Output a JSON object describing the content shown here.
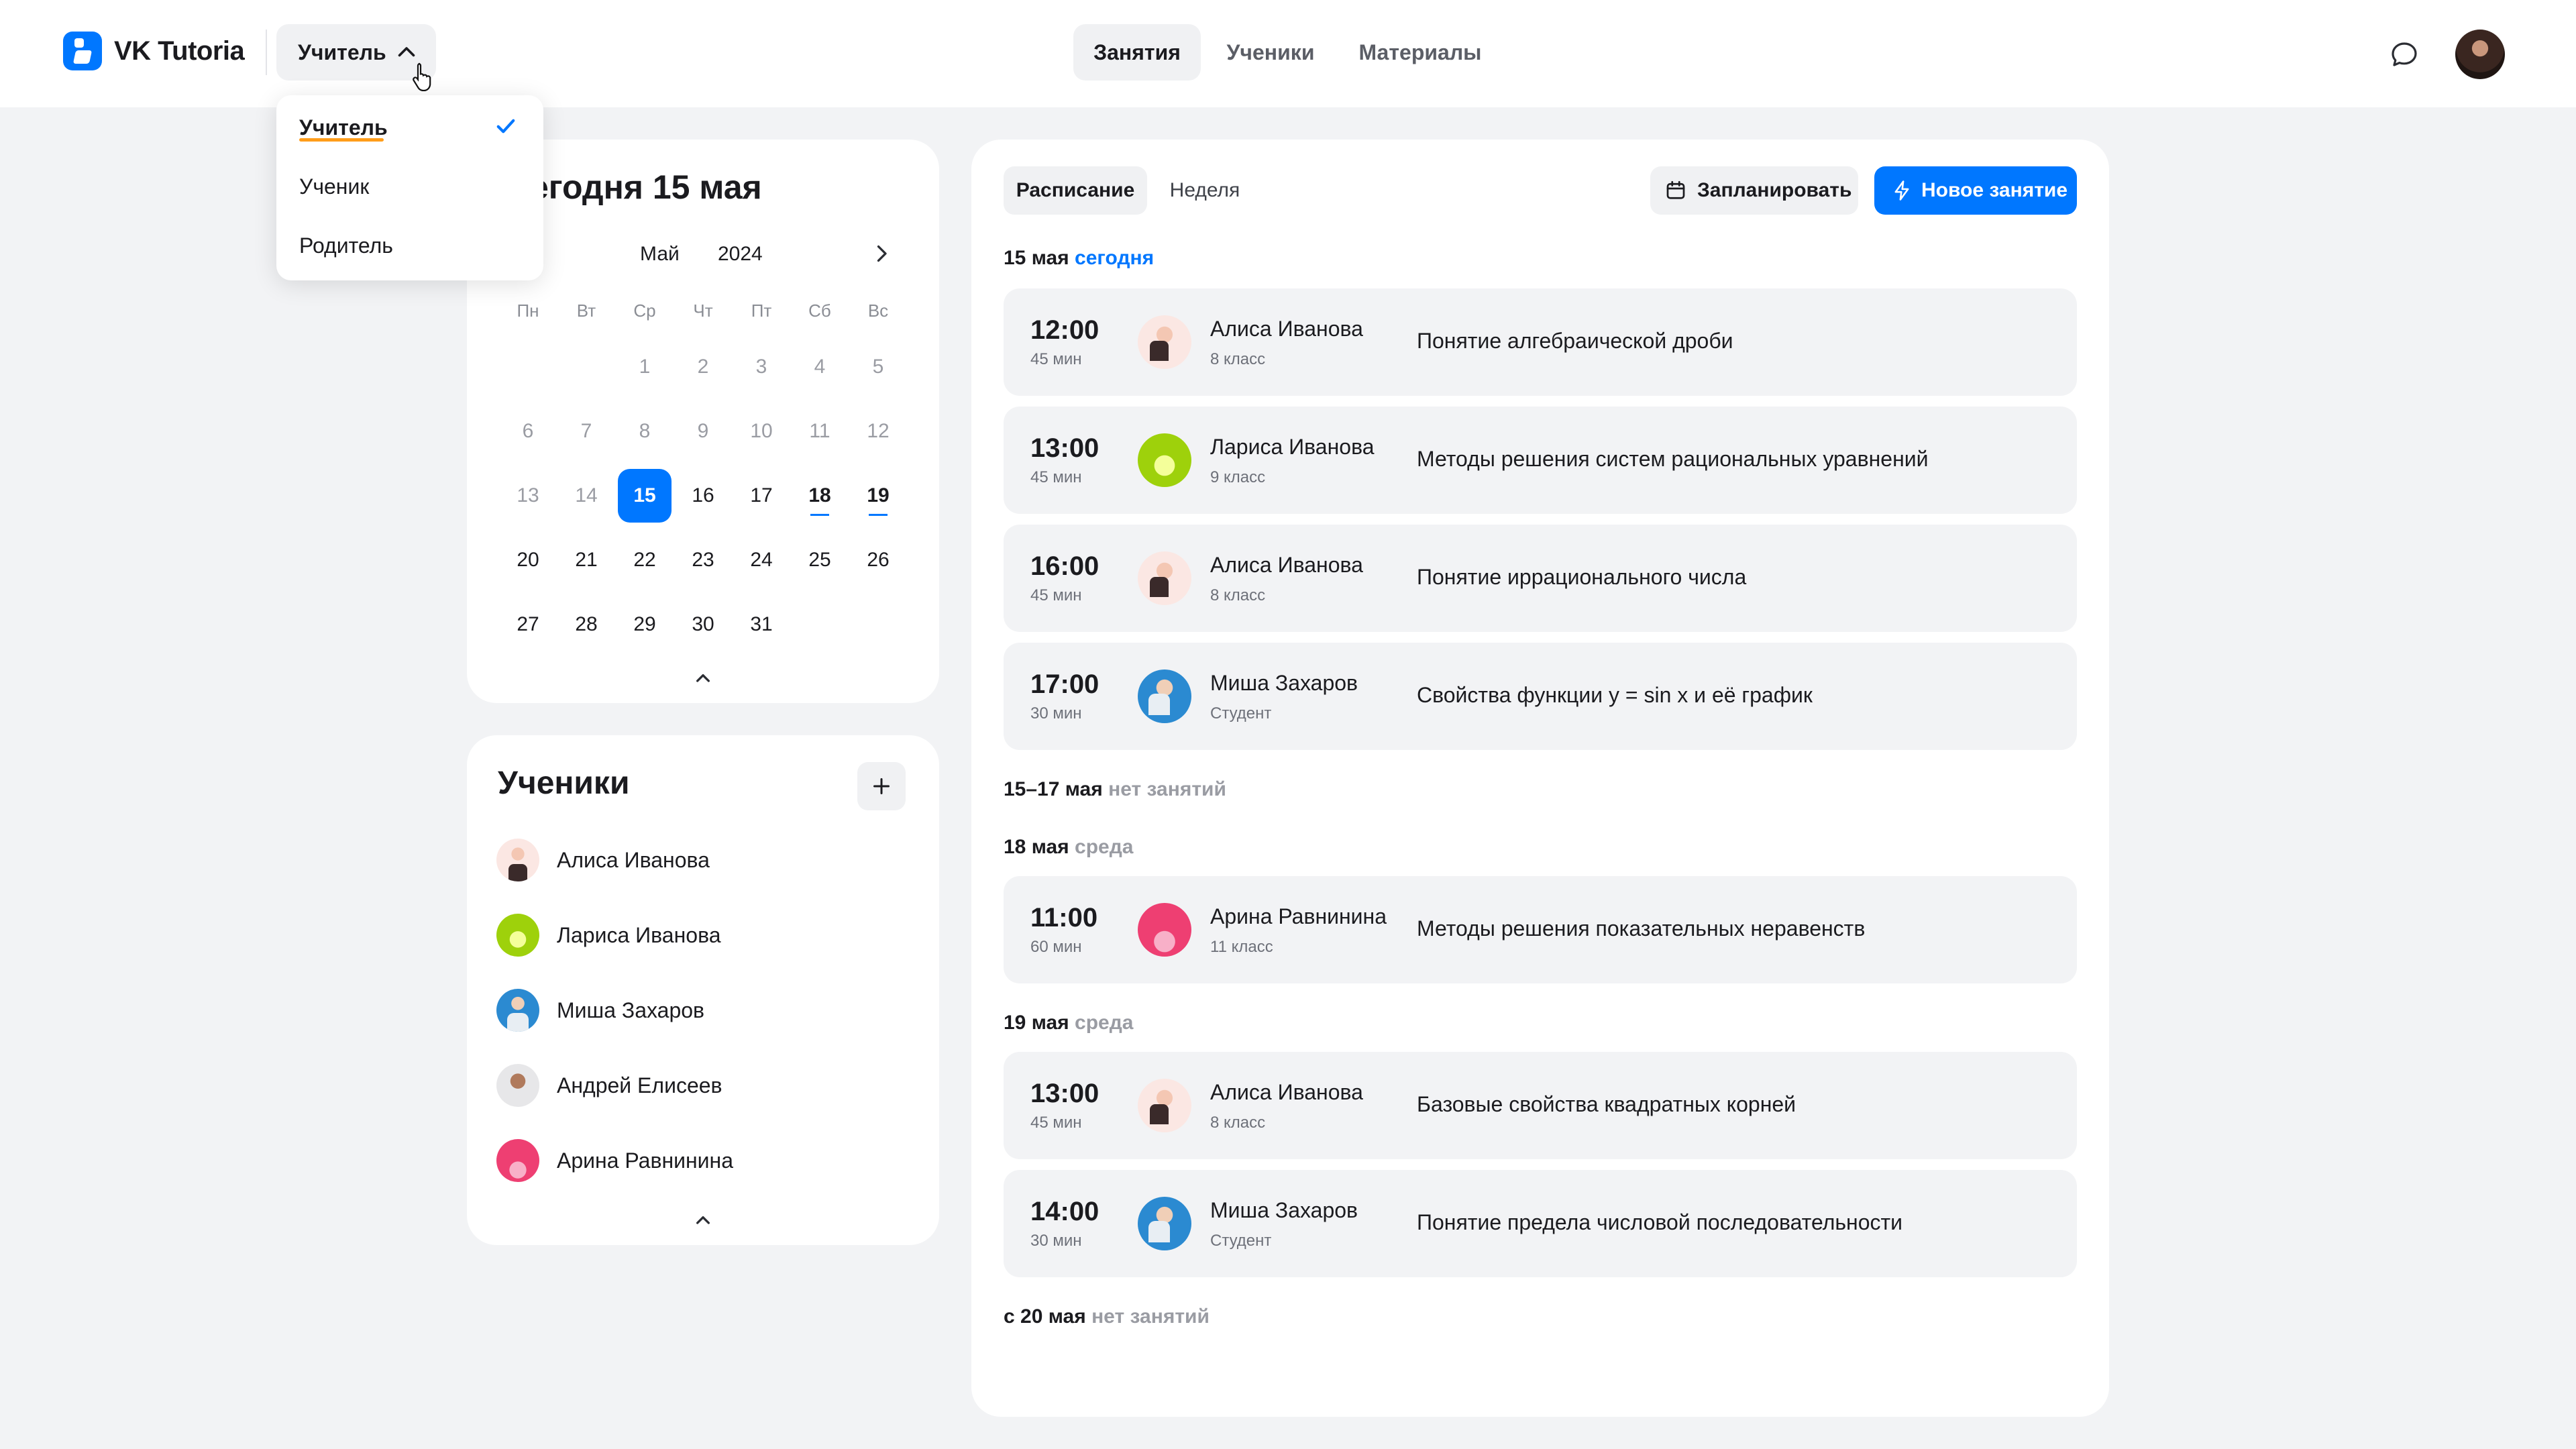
{
  "app": {
    "brand": "VK Tutoria"
  },
  "header": {
    "role_button": "Учитель",
    "nav": [
      "Занятия",
      "Ученики",
      "Материалы"
    ]
  },
  "role_menu": {
    "items": [
      "Учитель",
      "Ученик",
      "Родитель"
    ],
    "selected": "Учитель"
  },
  "calendar": {
    "title": "Сегодня 15 мая",
    "title_visible": "егодня 15 мая",
    "month": "Май",
    "year": "2024",
    "weekdays": [
      "Пн",
      "Вт",
      "Ср",
      "Чт",
      "Пт",
      "Сб",
      "Вс"
    ],
    "days": [
      "1",
      "2",
      "3",
      "4",
      "5",
      "6",
      "7",
      "8",
      "9",
      "10",
      "11",
      "12",
      "13",
      "14",
      "15",
      "16",
      "17",
      "18",
      "19",
      "20",
      "21",
      "22",
      "23",
      "24",
      "25",
      "26",
      "27",
      "28",
      "29",
      "30",
      "31"
    ],
    "today": "15",
    "marked_days": [
      "18",
      "19"
    ]
  },
  "students": {
    "title": "Ученики",
    "list": [
      "Алиса Иванова",
      "Лариса Иванова",
      "Миша Захаров",
      "Андрей Елисеев",
      "Арина Равнинина"
    ]
  },
  "schedule": {
    "tabs": [
      "Расписание",
      "Неделя"
    ],
    "plan_button": "Запланировать",
    "new_button": "Новое занятие",
    "groups": [
      {
        "date": "15 мая",
        "note": "сегодня"
      },
      {
        "date": "15–17 мая",
        "note": "нет занятий"
      },
      {
        "date": "18 мая",
        "note": "среда"
      },
      {
        "date": "19 мая",
        "note": "среда"
      },
      {
        "date": "с 20 мая",
        "note": "нет занятий"
      }
    ],
    "lessons": [
      {
        "time": "12:00",
        "duration": "45 мин",
        "student": "Алиса Иванова",
        "grade": "8 класс",
        "topic": "Понятие алгебраической дроби"
      },
      {
        "time": "13:00",
        "duration": "45 мин",
        "student": "Лариса Иванова",
        "grade": "9 класс",
        "topic": "Методы решения систем рациональных уравнений"
      },
      {
        "time": "16:00",
        "duration": "45 мин",
        "student": "Алиса Иванова",
        "grade": "8 класс",
        "topic": "Понятие иррационального числа"
      },
      {
        "time": "17:00",
        "duration": "30 мин",
        "student": "Миша Захаров",
        "grade": "Студент",
        "topic": "Свойства функции y = sin x и её график"
      },
      {
        "time": "11:00",
        "duration": "60 мин",
        "student": "Арина Равнинина",
        "grade": "11 класс",
        "topic": "Методы решения показательных неравенств"
      },
      {
        "time": "13:00",
        "duration": "45 мин",
        "student": "Алиса Иванова",
        "grade": "8 класс",
        "topic": "Базовые свойства квадратных корней"
      },
      {
        "time": "14:00",
        "duration": "30 мин",
        "student": "Миша Захаров",
        "grade": "Студент",
        "topic": "Понятие предела числовой последовательности"
      }
    ]
  },
  "colors": {
    "accent": "#0077ff",
    "selection_underline": "#ff9d1a",
    "background": "#f2f3f5"
  }
}
